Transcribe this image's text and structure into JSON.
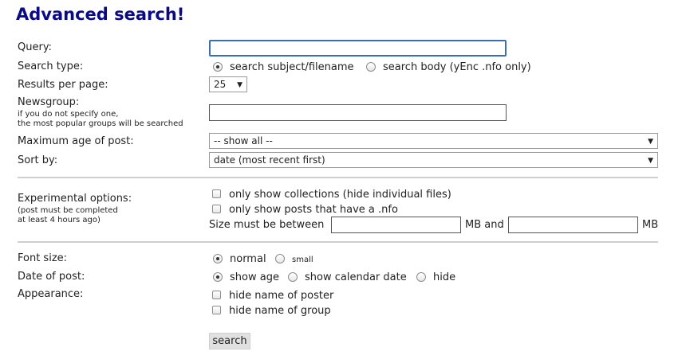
{
  "title": "Advanced search!",
  "labels": {
    "query": "Query:",
    "search_type": "Search type:",
    "results_per_page": "Results per page:",
    "newsgroup": "Newsgroup:",
    "newsgroup_note_1": "if you do not specify one,",
    "newsgroup_note_2": "the most popular groups will be searched",
    "max_age": "Maximum age of post:",
    "sort_by": "Sort by:",
    "experimental": "Experimental options:",
    "experimental_note_1": "(post must be completed",
    "experimental_note_2": "at least 4 hours ago)",
    "font_size": "Font size:",
    "date_of_post": "Date of post:",
    "appearance": "Appearance:"
  },
  "query": {
    "value": "",
    "placeholder": ""
  },
  "search_type": {
    "selected": "subject",
    "options": [
      "search subject/filename",
      "search body (yEnc .nfo only)"
    ]
  },
  "results_per_page": {
    "value": "25"
  },
  "newsgroup": {
    "value": ""
  },
  "max_age": {
    "value": "-- show all --"
  },
  "sort_by": {
    "value": "date (most recent first)"
  },
  "experimental": {
    "only_collections": "only show collections (hide individual files)",
    "only_nfo": "only show posts that have a .nfo",
    "size_label": "Size must be between",
    "mb_and": "MB and",
    "mb": "MB",
    "size_min": "",
    "size_max": ""
  },
  "font_size": {
    "selected": "normal",
    "options": [
      "normal",
      "small"
    ]
  },
  "date_of_post": {
    "selected": "show age",
    "options": [
      "show age",
      "show calendar date",
      "hide"
    ]
  },
  "appearance": {
    "hide_poster": "hide name of poster",
    "hide_group": "hide name of group"
  },
  "search_button": "search"
}
